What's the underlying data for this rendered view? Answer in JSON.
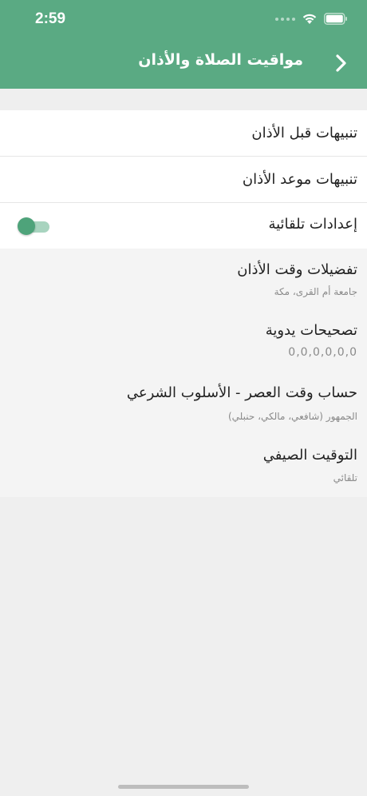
{
  "status_bar": {
    "time": "2:59"
  },
  "header": {
    "title": "مواقيت الصلاة والأذان"
  },
  "settings": [
    {
      "label": "تنبيهات قبل الأذان"
    },
    {
      "label": "تنبيهات موعد الأذان"
    },
    {
      "label": "إعدادات تلقائية",
      "toggle_on": true
    }
  ],
  "preferences": [
    {
      "title": "تفضيلات وقت الأذان",
      "subtitle": "جامعة أم القرى، مكة"
    },
    {
      "title": "تصحيحات يدوية",
      "subtitle": "0,0,0,0,0,0"
    },
    {
      "title": "حساب وقت العصر - الأسلوب الشرعي",
      "subtitle": "الجمهور (شافعي، مالكي، حنبلي)"
    },
    {
      "title": "التوقيت الصيفي",
      "subtitle": "تلقائي"
    }
  ],
  "colors": {
    "accent": "#5aaa83",
    "toggle": "#4ea37a"
  }
}
